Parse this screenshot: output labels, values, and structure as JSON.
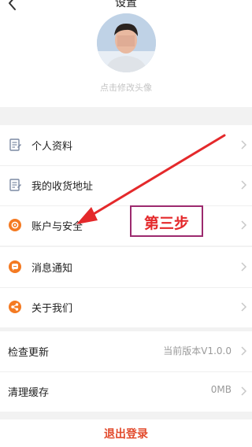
{
  "header": {
    "title": "设置",
    "avatar_hint": "点击修改头像"
  },
  "groups": {
    "profile": [
      {
        "label": "个人资料",
        "icon": "document-icon"
      },
      {
        "label": "我的收货地址",
        "icon": "document-icon"
      },
      {
        "label": "账户与安全",
        "icon": "gear-icon"
      }
    ],
    "social": [
      {
        "label": "消息通知",
        "icon": "message-icon"
      },
      {
        "label": "关于我们",
        "icon": "share-icon"
      }
    ],
    "system": [
      {
        "label": "检查更新",
        "value": "当前版本V1.0.0"
      },
      {
        "label": "清理缓存",
        "value": "0MB"
      }
    ]
  },
  "logout": {
    "label": "退出登录"
  },
  "annotation": {
    "text": "第三步"
  },
  "colors": {
    "accent": "#f47a22",
    "logout": "#e24a2c",
    "annotation": "#e4292b",
    "annotation_border": "#9c2a6e"
  }
}
